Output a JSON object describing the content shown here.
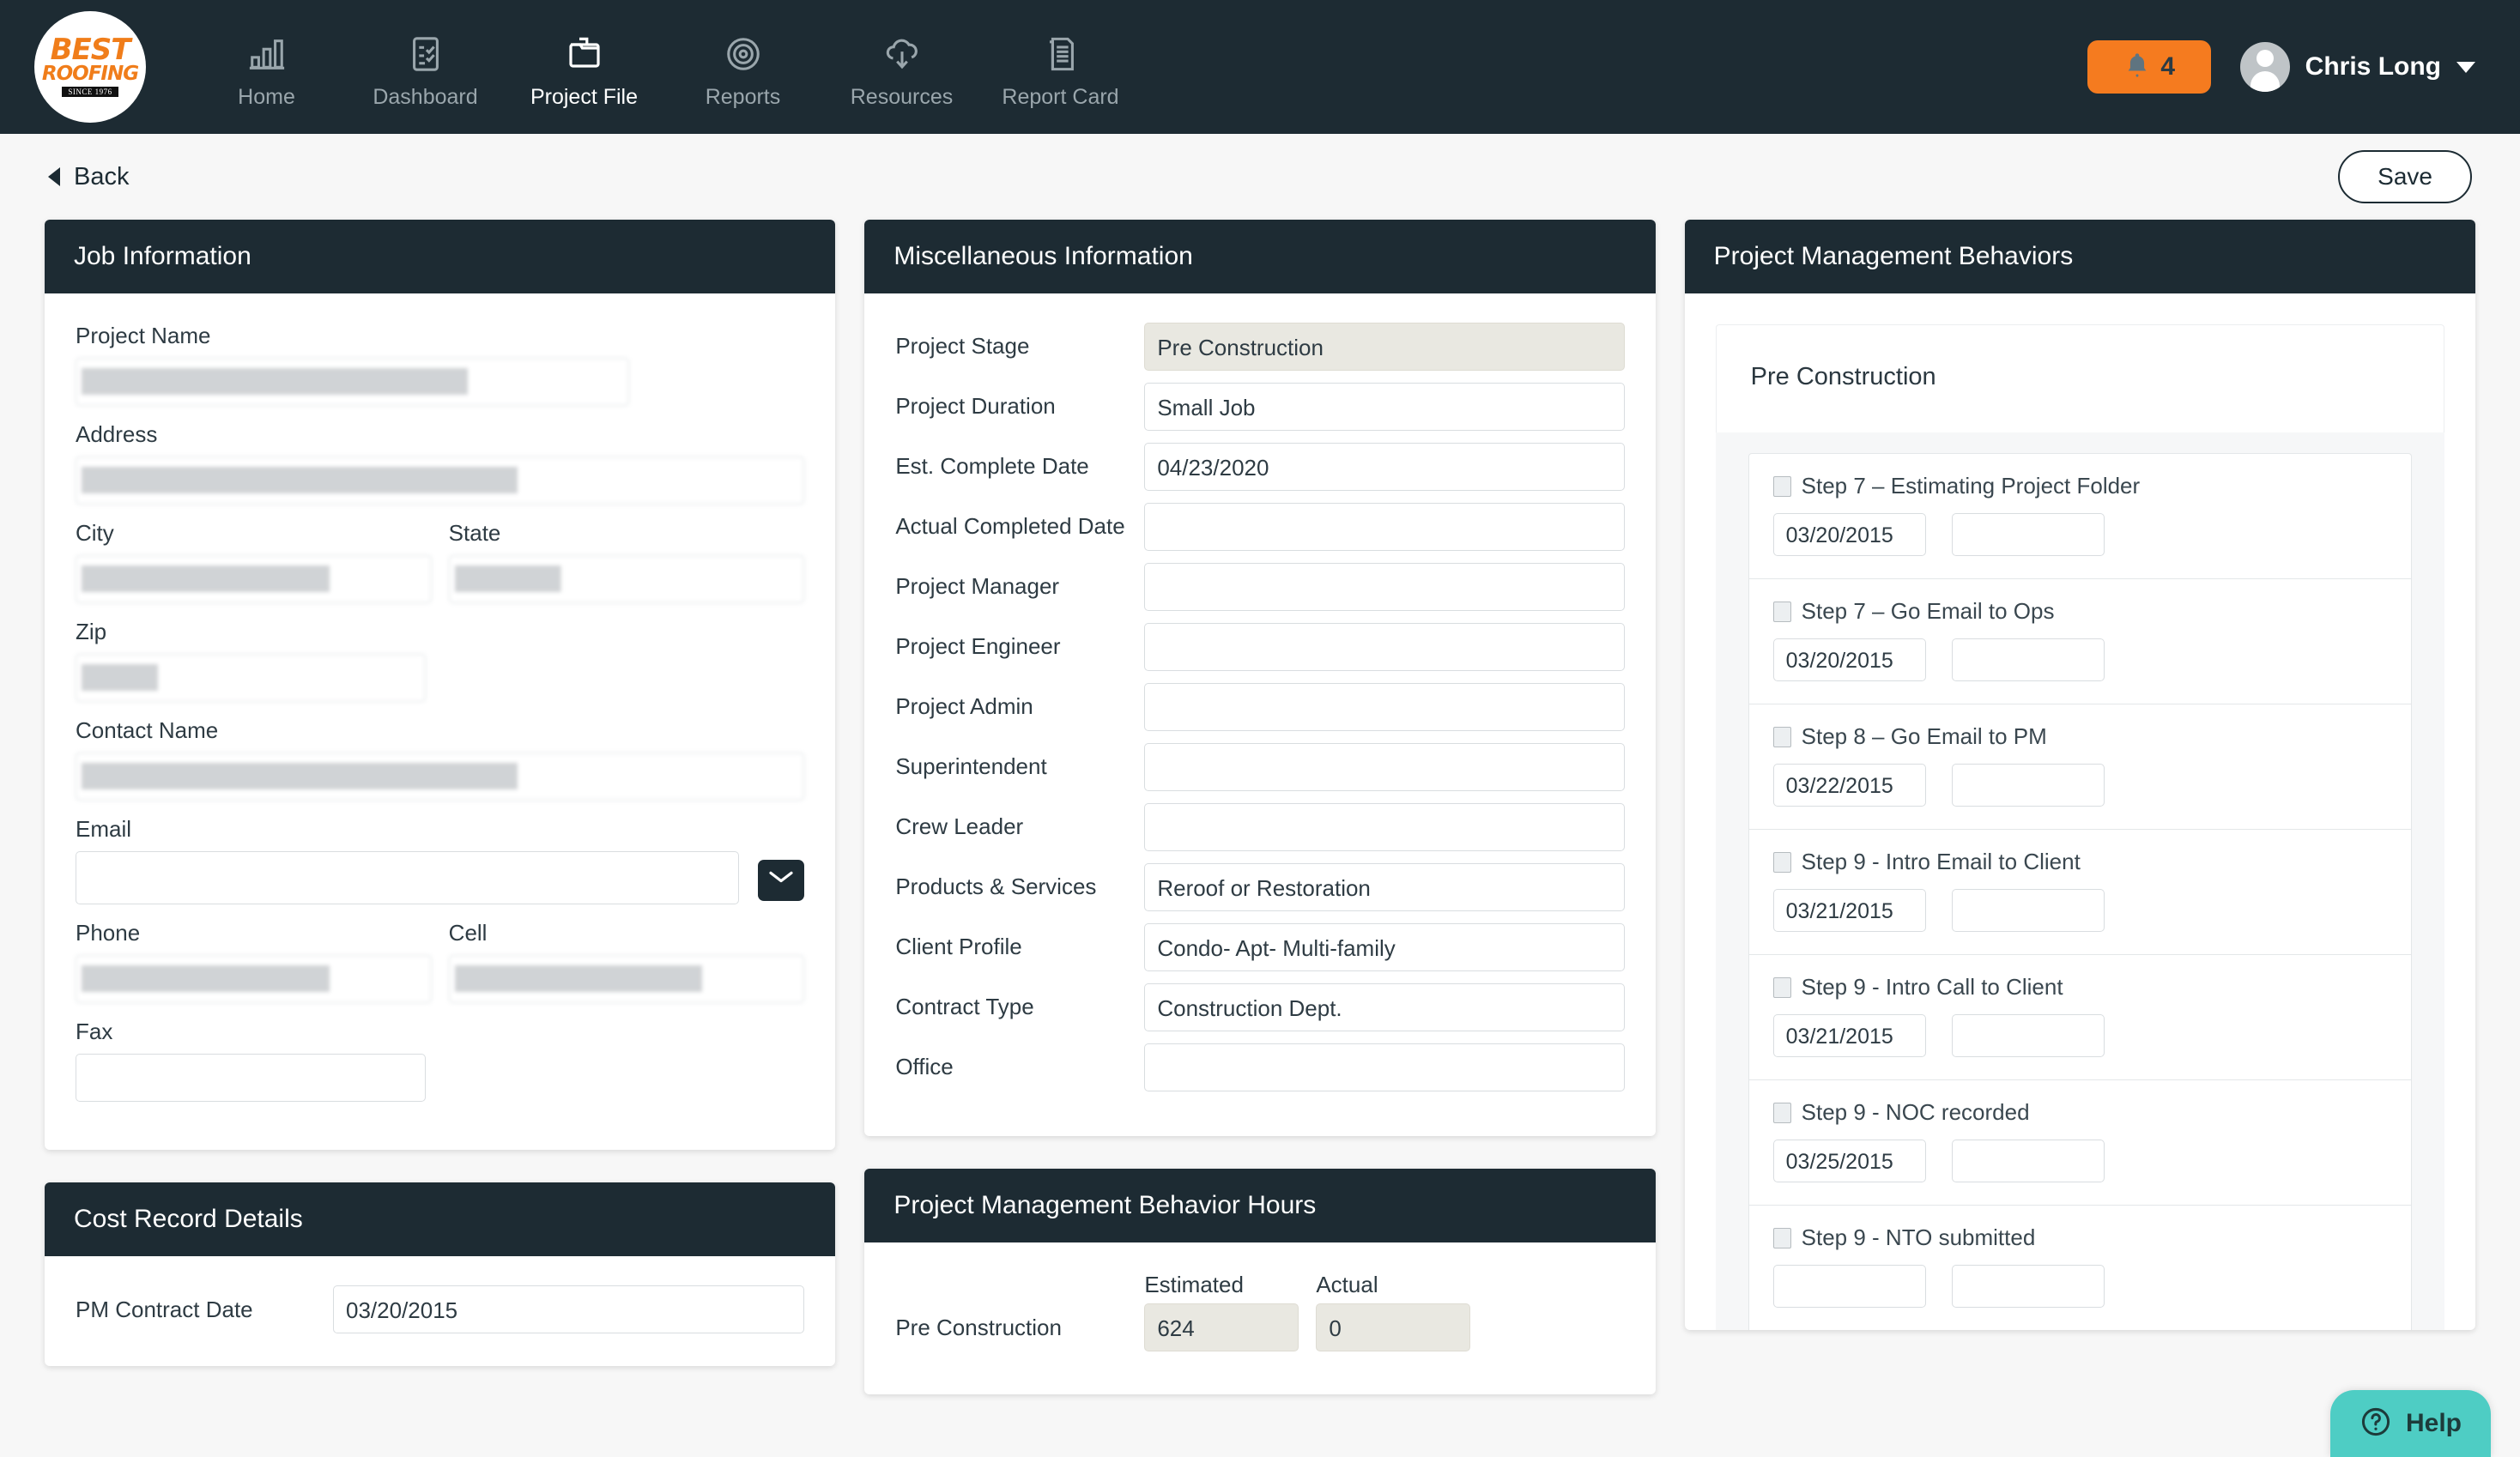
{
  "brand": {
    "logo_line1": "BEST",
    "logo_line2": "ROOFING",
    "logo_since": "SINCE 1976",
    "accent_orange": "#f57b1f",
    "dark": "#1d2b33",
    "teal": "#4ecdc4"
  },
  "topnav": {
    "items": [
      {
        "label": "Home",
        "icon": "bar-chart-icon",
        "active": false
      },
      {
        "label": "Dashboard",
        "icon": "checklist-icon",
        "active": false
      },
      {
        "label": "Project File",
        "icon": "folder-icon",
        "active": true
      },
      {
        "label": "Reports",
        "icon": "target-icon",
        "active": false
      },
      {
        "label": "Resources",
        "icon": "cloud-download-icon",
        "active": false
      },
      {
        "label": "Report Card",
        "icon": "document-icon",
        "active": false
      }
    ],
    "notification_count": "4",
    "user_name": "Chris Long"
  },
  "subbar": {
    "back_label": "Back",
    "save_label": "Save"
  },
  "job_information": {
    "title": "Job Information",
    "fields": {
      "project_name_label": "Project Name",
      "project_name_value": "",
      "address_label": "Address",
      "address_value": "",
      "city_label": "City",
      "city_value": "",
      "state_label": "State",
      "state_value": "",
      "zip_label": "Zip",
      "zip_value": "",
      "contact_name_label": "Contact Name",
      "contact_name_value": "",
      "email_label": "Email",
      "email_value": "",
      "phone_label": "Phone",
      "phone_value": "",
      "cell_label": "Cell",
      "cell_value": "",
      "fax_label": "Fax",
      "fax_value": ""
    }
  },
  "cost_record_details": {
    "title": "Cost Record Details",
    "pm_contract_date_label": "PM Contract Date",
    "pm_contract_date_value": "03/20/2015"
  },
  "miscellaneous_information": {
    "title": "Miscellaneous Information",
    "rows": [
      {
        "label": "Project Stage",
        "value": "Pre Construction",
        "style": "gray"
      },
      {
        "label": "Project Duration",
        "value": "Small Job",
        "style": "plain"
      },
      {
        "label": "Est. Complete Date",
        "value": "04/23/2020",
        "style": "plain"
      },
      {
        "label": "Actual Completed Date",
        "value": "",
        "style": "plain"
      },
      {
        "label": "Project Manager",
        "value": "",
        "style": "plain"
      },
      {
        "label": "Project Engineer",
        "value": "",
        "style": "plain"
      },
      {
        "label": "Project Admin",
        "value": "",
        "style": "plain"
      },
      {
        "label": "Superintendent",
        "value": "",
        "style": "plain"
      },
      {
        "label": "Crew Leader",
        "value": "",
        "style": "plain"
      },
      {
        "label": "Products & Services",
        "value": "Reroof or Restoration",
        "style": "plain"
      },
      {
        "label": "Client Profile",
        "value": "Condo- Apt- Multi-family",
        "style": "plain"
      },
      {
        "label": "Contract Type",
        "value": "Construction Dept.",
        "style": "plain"
      },
      {
        "label": "Office",
        "value": "",
        "style": "plain"
      }
    ]
  },
  "behavior_hours": {
    "title": "Project Management Behavior Hours",
    "col_estimated": "Estimated",
    "col_actual": "Actual",
    "rows": [
      {
        "label": "Pre Construction",
        "estimated": "624",
        "actual": "0"
      }
    ]
  },
  "project_management_behaviors": {
    "title": "Project Management Behaviors",
    "stage_label": "Pre Construction",
    "steps": [
      {
        "label": "Step 7 – Estimating Project Folder",
        "checked": false,
        "date": "03/20/2015",
        "note": ""
      },
      {
        "label": "Step 7 – Go Email to Ops",
        "checked": false,
        "date": "03/20/2015",
        "note": ""
      },
      {
        "label": "Step 8 – Go Email to PM",
        "checked": false,
        "date": "03/22/2015",
        "note": ""
      },
      {
        "label": "Step 9 - Intro Email to Client",
        "checked": false,
        "date": "03/21/2015",
        "note": ""
      },
      {
        "label": "Step 9 - Intro Call to Client",
        "checked": false,
        "date": "03/21/2015",
        "note": ""
      },
      {
        "label": "Step 9 - NOC recorded",
        "checked": false,
        "date": "03/25/2015",
        "note": ""
      },
      {
        "label": "Step 9 - NTO submitted",
        "checked": false,
        "date": "",
        "note": ""
      }
    ]
  },
  "help_widget": {
    "label": "Help"
  }
}
